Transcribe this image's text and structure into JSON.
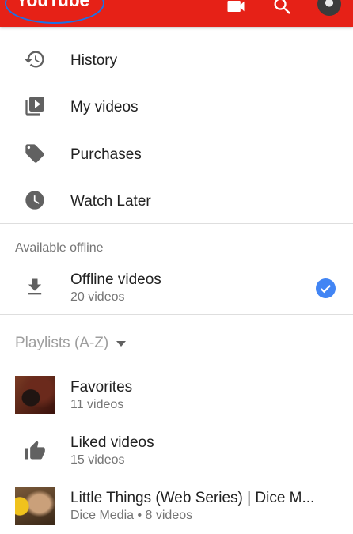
{
  "appbar": {
    "logo": "YouTube",
    "brand_color": "#e62117",
    "icons": [
      "video-camera-icon",
      "search-icon",
      "avatar"
    ]
  },
  "library": {
    "items": [
      {
        "label": "History",
        "icon": "history-icon"
      },
      {
        "label": "My videos",
        "icon": "my-videos-icon"
      },
      {
        "label": "Purchases",
        "icon": "purchases-tag-icon"
      },
      {
        "label": "Watch Later",
        "icon": "watch-later-clock-icon"
      }
    ]
  },
  "offline": {
    "header": "Available offline",
    "item": {
      "label": "Offline videos",
      "sub": "20 videos",
      "icon": "download-icon",
      "checked": true
    }
  },
  "playlists": {
    "header": "Playlists (A-Z)",
    "items": [
      {
        "label": "Favorites",
        "sub": "11 videos",
        "icon": "thumbnail"
      },
      {
        "label": "Liked videos",
        "sub": "15 videos",
        "icon": "thumbs-up-icon"
      },
      {
        "label": "Little Things (Web Series) | Dice M...",
        "sub": "Dice Media • 8 videos",
        "icon": "thumbnail"
      }
    ]
  },
  "colors": {
    "check_badge": "#4285f4",
    "icon_gray": "#616161",
    "secondary_text": "#757575"
  }
}
